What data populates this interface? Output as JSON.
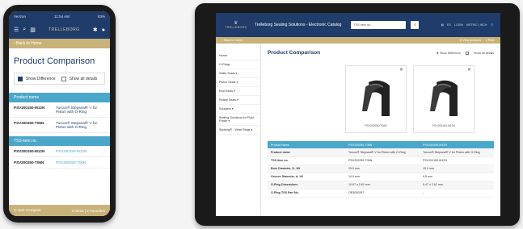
{
  "phone": {
    "status": {
      "left": "Verizon",
      "center": "11:54 AM",
      "right": "83%"
    },
    "logo": "TRELLEBORG",
    "back_label": "‹ Back to Home",
    "page_title": "Product Comparison",
    "show_difference": "Show Difference",
    "show_all": "Show all details",
    "section_product_name": "Product name",
    "rows": [
      {
        "key": "PSV200150-M12N",
        "value_pre": "Turcon® Stepseal® ",
        "value_accent": "V",
        "value_post": " for Piston with O-Ring"
      },
      {
        "key": "PSV200250-T06N",
        "value_pre": "Turcon® Stepseal® V",
        "value_accent": "",
        "value_post": " for Piston with O-Ring"
      }
    ],
    "section_tss": "TSS item no.",
    "tss_rows": [
      {
        "key": "PSV200150-M12N",
        "value": "PSV200150-M12N"
      },
      {
        "key": "PSV200250-T06N",
        "value": "PSV200250-T06N"
      }
    ],
    "footer_left": "⊙ Quit Compare",
    "footer_right": "2 Items | 2 Favorites"
  },
  "tablet": {
    "logo": "TRELLEBORG",
    "app_title": "Trelleborg Sealing Solutions - Electronic Catalog",
    "search_value": "TSS item no.",
    "header_right": [
      "▤",
      "ES",
      "LOGIN",
      "METRIC | INCH",
      "👤"
    ],
    "band_left": "‹ Back to Home",
    "band_right": [
      "★ View products",
      "⤓ Print"
    ],
    "side_items": [
      "Home",
      "O-Rings",
      "Static Seals ▾",
      "Piston Seals ▾",
      "Rod Seals ▾",
      "Rotary Seals ▾",
      "Scrapers ▾",
      "Sealing Solutions for Fluid Power ▾",
      "Slydring® - Wear Rings ▾"
    ],
    "page_title": "Product Comparison",
    "show_difference": "✚ Show Difference",
    "show_all": "Show all details",
    "cards": [
      {
        "caption": "PSV200250-T06N"
      },
      {
        "caption": "PSV200150-M12N"
      }
    ],
    "table_head": [
      "Product Name",
      "PSV200250-T06N",
      "PSV200150-M12N"
    ],
    "table_rows": [
      [
        "Product name",
        "Turcon® Stepseal® V for Piston with O-Ring",
        "Turcon® Stepseal® V for Piston with O-Ring"
      ],
      [
        "TSS item no.",
        "PSV200250-T06N",
        "PSV200150-M12N"
      ],
      [
        "Bore Diameter, D₁ H9",
        "25.0 mm",
        "15.0 mm"
      ],
      [
        "Groove Diameter, d₁ h9",
        "14.0 mm",
        "9.5 mm"
      ],
      [
        "O-Ring Dimensions",
        "10.87 x 2.62 mm",
        "5.47 x 2.62 mm"
      ],
      [
        "O-Ring TSS Part No.",
        "OR3000267",
        "–"
      ]
    ]
  },
  "colors": {
    "navy": "#1f3c6b",
    "gold": "#c9b27a",
    "teal": "#4aa7c9"
  }
}
